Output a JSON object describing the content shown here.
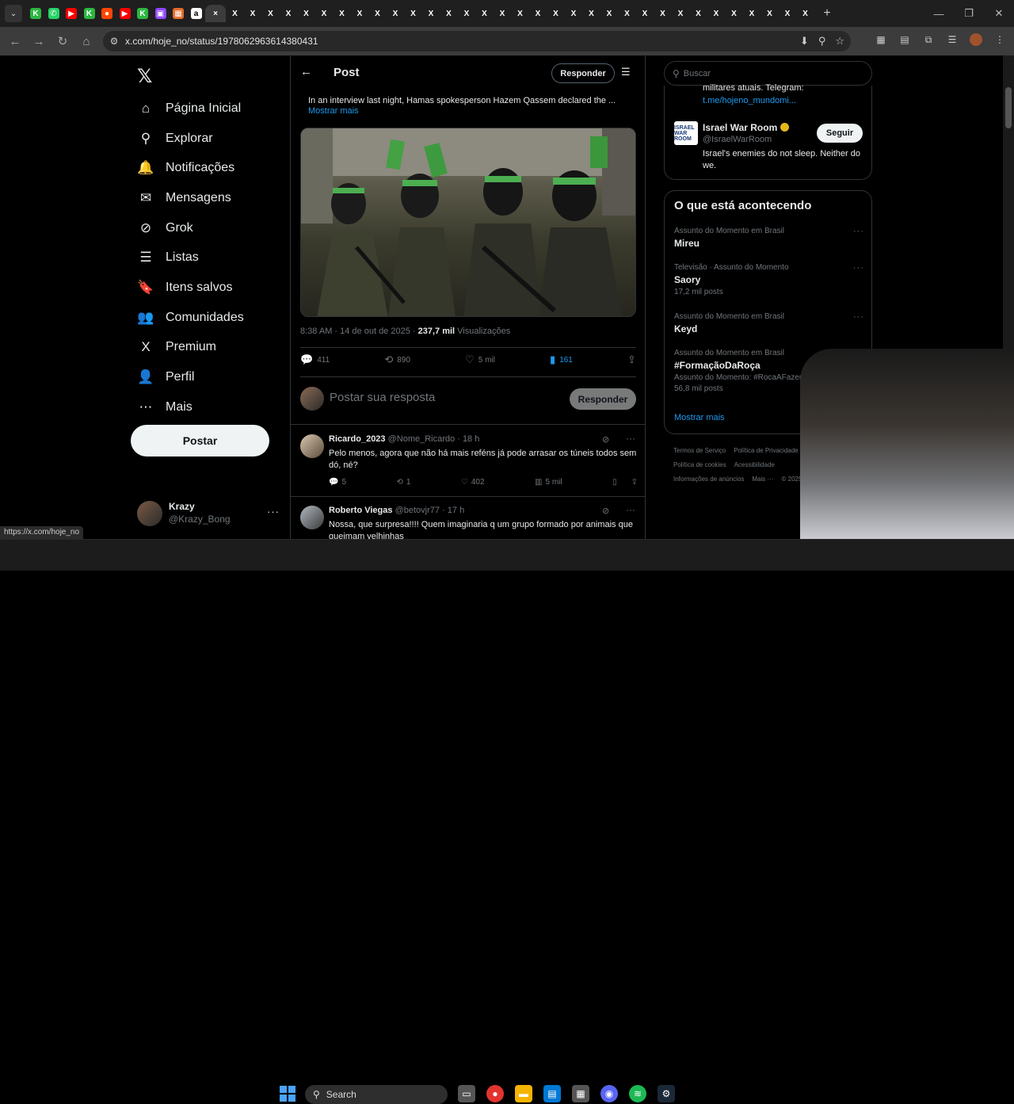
{
  "browser": {
    "tabs": [
      {
        "glyph": "K",
        "color": "#2bb741"
      },
      {
        "glyph": "✆",
        "color": "#25d366"
      },
      {
        "glyph": "▶",
        "color": "#ff0000"
      },
      {
        "glyph": "K",
        "color": "#2bb741"
      },
      {
        "glyph": "●",
        "color": "#ff4500"
      },
      {
        "glyph": "▶",
        "color": "#ff0000"
      },
      {
        "glyph": "K",
        "color": "#2bb741"
      },
      {
        "glyph": "▣",
        "color": "#9146ff"
      },
      {
        "glyph": "▦",
        "color": "#e86b2b"
      },
      {
        "glyph": "a",
        "color": "#ffffff"
      },
      {
        "glyph": "×",
        "color": "#3c3c3c"
      },
      {
        "glyph": "X",
        "color": "#1f1f1f"
      },
      {
        "glyph": "X",
        "color": "#1f1f1f"
      },
      {
        "glyph": "X",
        "color": "#1f1f1f"
      },
      {
        "glyph": "X",
        "color": "#1f1f1f"
      },
      {
        "glyph": "X",
        "color": "#1f1f1f"
      },
      {
        "glyph": "X",
        "color": "#1f1f1f"
      },
      {
        "glyph": "X",
        "color": "#1f1f1f"
      },
      {
        "glyph": "X",
        "color": "#1f1f1f"
      },
      {
        "glyph": "X",
        "color": "#1f1f1f"
      },
      {
        "glyph": "X",
        "color": "#1f1f1f"
      },
      {
        "glyph": "X",
        "color": "#1f1f1f"
      },
      {
        "glyph": "X",
        "color": "#1f1f1f"
      },
      {
        "glyph": "X",
        "color": "#1f1f1f"
      },
      {
        "glyph": "X",
        "color": "#1f1f1f"
      },
      {
        "glyph": "X",
        "color": "#1f1f1f"
      },
      {
        "glyph": "X",
        "color": "#1f1f1f"
      },
      {
        "glyph": "X",
        "color": "#1f1f1f"
      },
      {
        "glyph": "X",
        "color": "#1f1f1f"
      },
      {
        "glyph": "X",
        "color": "#1f1f1f"
      },
      {
        "glyph": "X",
        "color": "#1f1f1f"
      },
      {
        "glyph": "X",
        "color": "#1f1f1f"
      },
      {
        "glyph": "X",
        "color": "#1f1f1f"
      },
      {
        "glyph": "X",
        "color": "#1f1f1f"
      },
      {
        "glyph": "X",
        "color": "#1f1f1f"
      },
      {
        "glyph": "X",
        "color": "#1f1f1f"
      },
      {
        "glyph": "X",
        "color": "#1f1f1f"
      },
      {
        "glyph": "X",
        "color": "#1f1f1f"
      },
      {
        "glyph": "X",
        "color": "#1f1f1f"
      },
      {
        "glyph": "X",
        "color": "#1f1f1f"
      },
      {
        "glyph": "X",
        "color": "#1f1f1f"
      },
      {
        "glyph": "X",
        "color": "#1f1f1f"
      },
      {
        "glyph": "X",
        "color": "#1f1f1f"
      },
      {
        "glyph": "X",
        "color": "#1f1f1f"
      }
    ],
    "url": "x.com/hoje_no/status/1978062963614380431",
    "status_url": "https://x.com/hoje_no"
  },
  "nav": {
    "items": [
      {
        "label": "Página Inicial",
        "icon": "⌂"
      },
      {
        "label": "Explorar",
        "icon": "⚲"
      },
      {
        "label": "Notificações",
        "icon": "🔔"
      },
      {
        "label": "Mensagens",
        "icon": "✉"
      },
      {
        "label": "Grok",
        "icon": "⊘"
      },
      {
        "label": "Listas",
        "icon": "☰"
      },
      {
        "label": "Itens salvos",
        "icon": "🔖"
      },
      {
        "label": "Comunidades",
        "icon": "👥"
      },
      {
        "label": "Premium",
        "icon": "X"
      },
      {
        "label": "Perfil",
        "icon": "👤"
      },
      {
        "label": "Mais",
        "icon": "⋯"
      }
    ],
    "post_label": "Postar",
    "account": {
      "name": "Krazy",
      "handle": "@Krazy_Bong"
    }
  },
  "main": {
    "title": "Post",
    "reply_btn": "Responder",
    "tweet_text": "In an interview last night, Hamas spokesperson Hazem Qassem declared the ...",
    "show_more": "Mostrar mais",
    "meta": {
      "time": "8:38 AM · 14 de out de 2025 · ",
      "views": "237,7 mil",
      "views_label": " Visualizações"
    },
    "actions": {
      "replies": "411",
      "reposts": "890",
      "likes": "5 mil",
      "bookmarks": "161"
    },
    "reply_placeholder": "Postar sua resposta",
    "reply_submit": "Responder",
    "comments": [
      {
        "name": "Ricardo_2023",
        "handle": "@Nome_Ricardo",
        "time": "18 h",
        "text": "Pelo menos, agora que não há mais reféns já pode arrasar os túneis todos sem dó, né?",
        "replies": "5",
        "reposts": "1",
        "likes": "402",
        "views": "5 mil"
      },
      {
        "name": "Roberto Viegas",
        "handle": "@betovjr77",
        "time": "17 h",
        "text": "Nossa, que surpresa!!!! Quem imaginaria q um grupo formado por animais que queimam velhinhas"
      }
    ]
  },
  "right": {
    "search_placeholder": "Buscar",
    "follow": {
      "prev_text1": "militares atuais. Telegram:",
      "prev_text2": "t.me/hojeno_mundomi...",
      "name": "Israel War Room",
      "handle": "@IsraelWarRoom",
      "bio": "Israel's enemies do not sleep. Neither do we.",
      "button": "Seguir",
      "logo_text": "ISRAEL WAR ROOM"
    },
    "trends_title": "O que está acontecendo",
    "trends": [
      {
        "context": "Assunto do Momento em Brasil",
        "name": "Mireu",
        "count": ""
      },
      {
        "context": "Televisão · Assunto do Momento",
        "name": "Saory",
        "count": "17,2 mil posts"
      },
      {
        "context": "Assunto do Momento em Brasil",
        "name": "Keyd",
        "count": ""
      },
      {
        "context": "Assunto do Momento em Brasil",
        "name": "#FormaçãoDaRoça",
        "count": "56,8 mil posts",
        "extra_prefix": "Assunto do Momento: ",
        "extra_tag": "#RocaAFazenda"
      }
    ],
    "show_more": "Mostrar mais",
    "footer": [
      "Termos de Serviço",
      "Política de Privacidade",
      "Política de cookies",
      "Acessibilidade",
      "Informações de anúncios",
      "Mais ···",
      "© 2025 X C"
    ]
  },
  "taskbar": {
    "search": "Search"
  }
}
